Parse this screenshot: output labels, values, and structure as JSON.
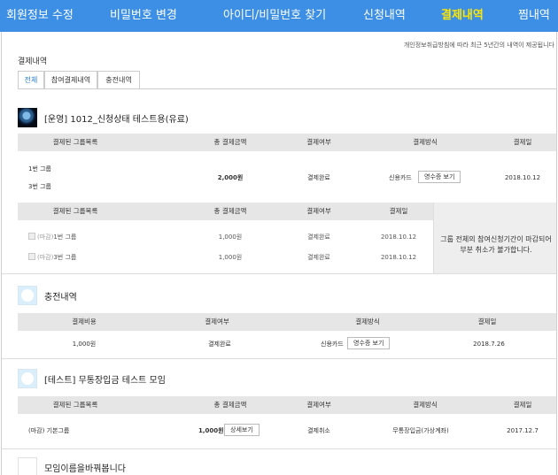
{
  "nav": {
    "items": [
      {
        "label": "회원정보 수정",
        "active": false
      },
      {
        "label": "비밀번호 변경",
        "active": false
      },
      {
        "label": "아이디/비밀번호 찾기",
        "active": false
      },
      {
        "label": "신청내역",
        "active": false
      },
      {
        "label": "결제내역",
        "active": true
      },
      {
        "label": "찜내역",
        "active": false
      }
    ],
    "bg_color": "#3c8fe4",
    "active_color": "#ffe600"
  },
  "notice": "개인정보취급방침에 따라 최근 5년간의 내역이 제공됩니다",
  "section_title": "결제내역",
  "tabs": [
    {
      "label": "전체",
      "active": true
    },
    {
      "label": "참여결제내역",
      "active": false
    },
    {
      "label": "충전내역",
      "active": false
    }
  ],
  "group1": {
    "thumb_icon": "earth-image",
    "title": "[운영] 1012_신청상태 테스트용(유료)",
    "headers": [
      "결제된 그룹목록",
      "총 결제금액",
      "결제여부",
      "결제방식",
      "결제일"
    ],
    "row": {
      "groups": [
        "1번 그룹",
        "3번 그룹"
      ],
      "amount": "2,000원",
      "status": "결제완료",
      "method": "신용카드",
      "receipt_button": "영수증 보기",
      "date": "2018.10.12"
    },
    "sub_headers": [
      "결제된 그룹목록",
      "총 결제금액",
      "결제여부",
      "결제일"
    ],
    "sub_rows": [
      {
        "prefix": "(마감)",
        "name": "1번 그룹",
        "amount": "1,000원",
        "status": "결제완료",
        "date": "2018.10.12"
      },
      {
        "prefix": "(마감)",
        "name": "3번 그룹",
        "amount": "1,000원",
        "status": "결제완료",
        "date": "2018.10.12"
      }
    ],
    "cancel_notice": "그룹 전체의 참여신청기간이 마감되어 부분 취소가 불가합니다."
  },
  "charge": {
    "thumb_icon": "logo-placeholder",
    "title": "충전내역",
    "headers": [
      "결제비용",
      "결제여부",
      "결제방식",
      "결제일"
    ],
    "row": {
      "amount": "1,000원",
      "status": "결제완료",
      "method": "신용카드",
      "receipt_button": "영수증 보기",
      "date": "2018.7.26"
    }
  },
  "group2": {
    "thumb_icon": "logo-placeholder",
    "title": "[테스트] 무통장입금 테스트 모임",
    "headers": [
      "결제된 그룹목록",
      "총 결제금액",
      "결제여부",
      "결제방식",
      "결제일"
    ],
    "row": {
      "group": "(마감) 기본그룹",
      "amount": "1,000원",
      "detail_button": "상세보기",
      "status": "결제취소",
      "method": "무통장입금(가상계좌)",
      "date": "2017.12.7"
    }
  },
  "group3": {
    "thumb_icon": "blank-thumbnail",
    "title": "모임이름을바꿔봅니다"
  }
}
